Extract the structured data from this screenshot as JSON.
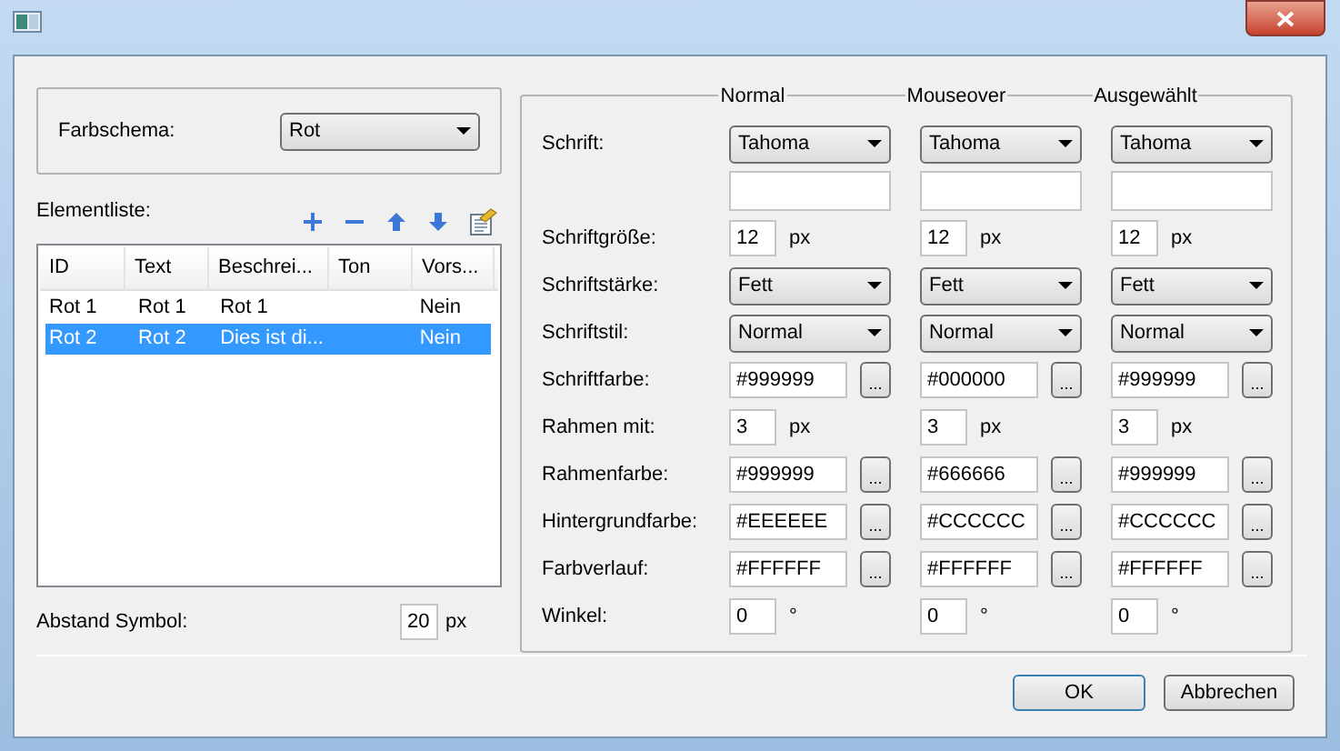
{
  "scheme": {
    "label": "Farbschema:",
    "value": "Rot"
  },
  "element_list": {
    "label": "Elementliste:",
    "columns": [
      "ID",
      "Text",
      "Beschrei...",
      "Ton",
      "Vors..."
    ],
    "rows": [
      {
        "id": "Rot 1",
        "text": "Rot 1",
        "description": "Rot 1",
        "default": "Nein",
        "selected": false
      },
      {
        "id": "Rot 2",
        "text": "Rot 2",
        "description": "Dies ist di...",
        "default": "Nein",
        "selected": true
      }
    ]
  },
  "spacing": {
    "label": "Abstand Symbol:",
    "value": "20",
    "unit": "px"
  },
  "style_columns": [
    "Normal",
    "Mouseover",
    "Ausgewählt"
  ],
  "style_rows": [
    {
      "kind": "combo",
      "label": "Schrift:",
      "cells": [
        {
          "value": "Tahoma"
        },
        {
          "value": "Tahoma"
        },
        {
          "value": "Tahoma"
        }
      ]
    },
    {
      "kind": "blank"
    },
    {
      "kind": "number",
      "label": "Schriftgröße:",
      "cells": [
        {
          "value": "12",
          "unit": "px"
        },
        {
          "value": "12",
          "unit": "px"
        },
        {
          "value": "12",
          "unit": "px"
        }
      ]
    },
    {
      "kind": "combo",
      "label": "Schriftstärke:",
      "cells": [
        {
          "value": "Fett"
        },
        {
          "value": "Fett"
        },
        {
          "value": "Fett"
        }
      ]
    },
    {
      "kind": "combo",
      "label": "Schriftstil:",
      "cells": [
        {
          "value": "Normal"
        },
        {
          "value": "Normal"
        },
        {
          "value": "Normal"
        }
      ]
    },
    {
      "kind": "color",
      "label": "Schriftfarbe:",
      "cells": [
        {
          "value": "#999999",
          "button": "..."
        },
        {
          "value": "#000000",
          "button": "..."
        },
        {
          "value": "#999999",
          "button": "..."
        }
      ]
    },
    {
      "kind": "number",
      "label": "Rahmen mit:",
      "cells": [
        {
          "value": "3",
          "unit": "px"
        },
        {
          "value": "3",
          "unit": "px"
        },
        {
          "value": "3",
          "unit": "px"
        }
      ]
    },
    {
      "kind": "color",
      "label": "Rahmenfarbe:",
      "cells": [
        {
          "value": "#999999",
          "button": "..."
        },
        {
          "value": "#666666",
          "button": "..."
        },
        {
          "value": "#999999",
          "button": "..."
        }
      ]
    },
    {
      "kind": "color",
      "label": "Hintergrundfarbe:",
      "cells": [
        {
          "value": "#EEEEEE",
          "button": "..."
        },
        {
          "value": "#CCCCCC",
          "button": "..."
        },
        {
          "value": "#CCCCCC",
          "button": "..."
        }
      ]
    },
    {
      "kind": "color",
      "label": "Farbverlauf:",
      "cells": [
        {
          "value": "#FFFFFF",
          "button": "..."
        },
        {
          "value": "#FFFFFF",
          "button": "..."
        },
        {
          "value": "#FFFFFF",
          "button": "..."
        }
      ]
    },
    {
      "kind": "number",
      "label": "Winkel:",
      "cells": [
        {
          "value": "0",
          "unit": "°"
        },
        {
          "value": "0",
          "unit": "°"
        },
        {
          "value": "0",
          "unit": "°"
        }
      ]
    }
  ],
  "buttons": [
    "OK",
    "Abbrechen"
  ]
}
